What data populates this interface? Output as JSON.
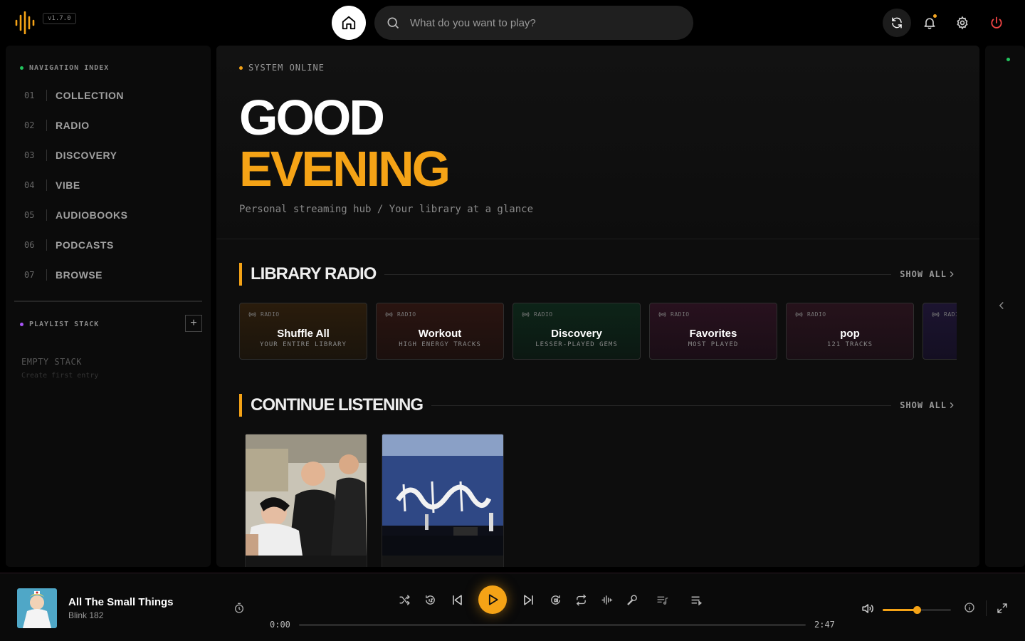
{
  "app": {
    "version": "v1.7.0"
  },
  "search": {
    "placeholder": "What do you want to play?"
  },
  "sidebar": {
    "nav_header": "NAVIGATION INDEX",
    "items": [
      {
        "num": "01",
        "label": "COLLECTION"
      },
      {
        "num": "02",
        "label": "RADIO"
      },
      {
        "num": "03",
        "label": "DISCOVERY"
      },
      {
        "num": "04",
        "label": "VIBE"
      },
      {
        "num": "05",
        "label": "AUDIOBOOKS"
      },
      {
        "num": "06",
        "label": "PODCASTS"
      },
      {
        "num": "07",
        "label": "BROWSE"
      }
    ],
    "playlist_header": "PLAYLIST STACK",
    "add_label": "+",
    "empty_title": "EMPTY STACK",
    "empty_hint": "Create first entry"
  },
  "hero": {
    "status": "SYSTEM ONLINE",
    "greeting_line1": "GOOD",
    "greeting_line2": "EVENING",
    "subtitle": "Personal streaming hub / Your library at a glance"
  },
  "library_radio": {
    "title": "LIBRARY RADIO",
    "show_all": "SHOW ALL",
    "cards": [
      {
        "tag": "RADIO",
        "name": "Shuffle All",
        "sub": "YOUR ENTIRE LIBRARY"
      },
      {
        "tag": "RADIO",
        "name": "Workout",
        "sub": "HIGH ENERGY TRACKS"
      },
      {
        "tag": "RADIO",
        "name": "Discovery",
        "sub": "LESSER-PLAYED GEMS"
      },
      {
        "tag": "RADIO",
        "name": "Favorites",
        "sub": "MOST PLAYED"
      },
      {
        "tag": "RADIO",
        "name": "pop",
        "sub": "121 TRACKS"
      },
      {
        "tag": "RADIO",
        "name": "",
        "sub": ""
      }
    ]
  },
  "continue_listening": {
    "title": "CONTINUE LISTENING",
    "show_all": "SHOW ALL"
  },
  "player": {
    "title": "All The Small Things",
    "artist": "Blink 182",
    "elapsed": "0:00",
    "duration": "2:47",
    "progress": 0.0,
    "volume": 0.5
  },
  "colors": {
    "accent": "#f5a316",
    "online": "#22c55e",
    "playlist_dot": "#a855f7",
    "power": "#ef4444"
  }
}
